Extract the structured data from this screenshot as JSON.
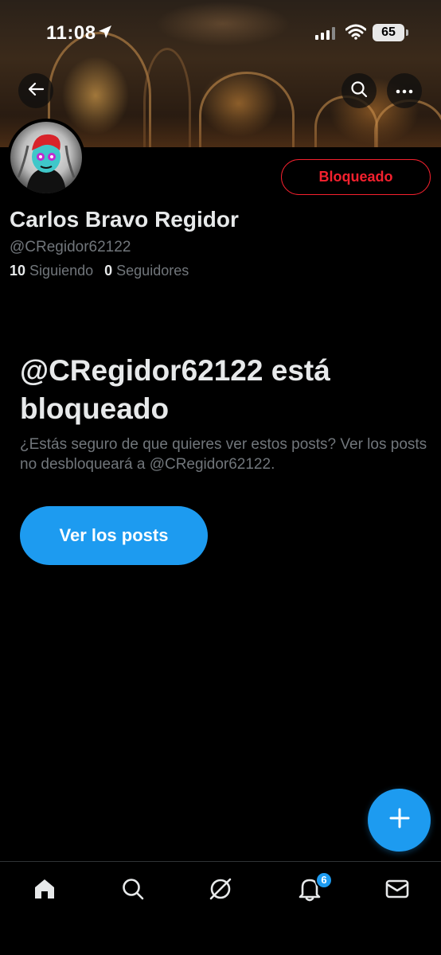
{
  "status_bar": {
    "time": "11:08",
    "battery": "65"
  },
  "header": {
    "back_icon": "arrow-left-icon",
    "search_icon": "search-icon",
    "more_icon": "more-horizontal-icon"
  },
  "profile": {
    "display_name": "Carlos Bravo Regidor",
    "handle": "@CRegidor62122",
    "following_count": "10",
    "following_label": "Siguiendo",
    "followers_count": "0",
    "followers_label": "Seguidores",
    "blocked_button_label": "Bloqueado"
  },
  "blocked_notice": {
    "title": "@CRegidor62122 está bloqueado",
    "description": "¿Estás seguro de que quieres ver estos posts? Ver los posts no desbloqueará a @CRegidor62122.",
    "view_posts_label": "Ver los posts"
  },
  "fab": {
    "icon": "plus-icon"
  },
  "bottom_nav": {
    "items": [
      {
        "icon": "home-icon"
      },
      {
        "icon": "search-icon"
      },
      {
        "icon": "grok-icon"
      },
      {
        "icon": "bell-icon",
        "badge": "6"
      },
      {
        "icon": "mail-icon"
      }
    ]
  },
  "colors": {
    "accent": "#1d9bf0",
    "danger": "#f4212e",
    "text_primary": "#e7e9ea",
    "text_secondary": "#71767b",
    "background": "#000000"
  }
}
